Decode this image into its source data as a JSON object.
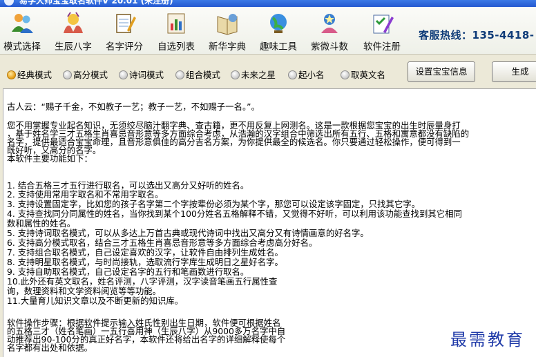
{
  "window": {
    "title": "易学大师宝宝取名软件V 20.01 (未注册)"
  },
  "toolbar": {
    "items": [
      {
        "label": "模式选择",
        "icon": "people-icon"
      },
      {
        "label": "生辰八字",
        "icon": "hands-icon"
      },
      {
        "label": "名字评分",
        "icon": "notepad-icon"
      },
      {
        "label": "自选列表",
        "icon": "chart-book-icon"
      },
      {
        "label": "新华字典",
        "icon": "dictionary-icon"
      },
      {
        "label": "趣味工具",
        "icon": "globe-icon"
      },
      {
        "label": "紫微斗数",
        "icon": "star-person-icon"
      },
      {
        "label": "软件注册",
        "icon": "register-icon"
      }
    ],
    "hotline": "客服热线：135-4418-"
  },
  "modes": {
    "options": [
      "经典模式",
      "高分模式",
      "诗词模式",
      "组合模式",
      "未来之星",
      "起小名",
      "取英文名"
    ],
    "selected": "经典模式",
    "set_info_button": "设置宝宝信息",
    "generate_button": "生成"
  },
  "content": {
    "lines": [
      "古人云：“赐子千金，不如教子一艺；教子一艺，不如赐子一名。”。",
      "",
      "您不用掌握专业起名知识，无须绞尽脑汁翻字典、查古籍，更不用反复上网测名。这是一款根据您宝宝的出生时辰量身打",
      "，基于姓名学三才五格生肖喜忌音形意等多方面综合考虑，从浩瀚的汉字组合中筛选出所有五行、五格和寓意都没有缺陷的",
      "名字，提供最适合宝宝命理，且音形意俱佳的高分吉名方案，为你提供最全的候选名。你只要通过轻松操作，便可得到一",
      "既好听，又高分的名字。",
      "本软件主要功能如下：",
      "",
      "1. 结合五格三才五行进行取名，可以选出又高分又好听的姓名。",
      "2. 支持使用常用字取名和不常用字取名。",
      "3. 支持设置固定字，比如您的孩子名字第二个字按辈份必须为某个字，那您可以设定该字固定，只找其它字。",
      "4. 支持查找同分同属性的姓名，当你找到某个100分姓名五格解释不错，又觉得不好听，可以利用该功能查找到其它相同",
      "数和属性的姓名。",
      "5. 支持诗词取名模式，可以从多达上万首古典或现代诗词中找出又高分又有诗情画意的好名字。",
      "6. 支持高分模式取名，结合三才五格生肖喜忌音形意等多方面综合考虑高分好名。",
      "7. 支持组合取名模式，自己设定喜欢的汉字，让软件自由排列生成姓名。",
      "8. 支持明星取名模式，与时尚接轨，选取流行字库生成明日之星好名字。",
      "9. 支持自助取名模式，自己设定名字的五行和笔画数进行取名。",
      "10.此外还有英文取名，姓名评测，八字评测，汉字读音笔画五行属性查",
      "询，数理资料和文学资料阅览等等功能。",
      "11.大量育儿知识文章以及不断更新的知识库。",
      "",
      "软件操作步骤：根据软件提示输入姓氏性别出生日期，软件便可根据姓名",
      "的五格三才（姓名笔画）一五行喜用神（生辰八字）从9000多万名字中自",
      "动推荐出90-100分的真正好名字，本软件还将给出名字的详细解释使每个",
      "名字都有出处和依据。"
    ]
  },
  "watermark": "最需教育",
  "colors": {
    "title_bar": "#2a5fd6",
    "hotline": "#0e3b78",
    "watermark": "#1f3aa8",
    "background": "#ece9d8"
  }
}
